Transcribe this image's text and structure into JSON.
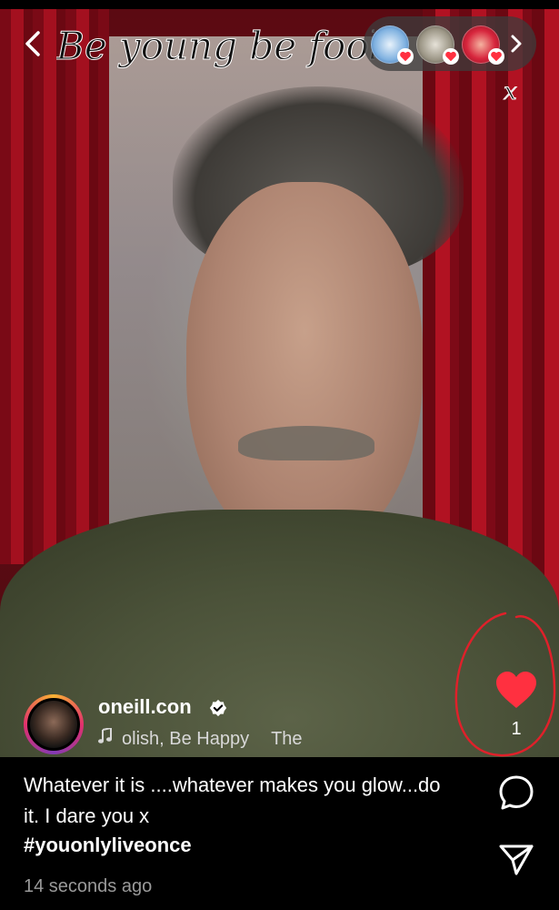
{
  "story": {
    "title": "Be young be foolish",
    "title_tail": "x",
    "back_icon": "chevron-left-icon"
  },
  "likers": {
    "count_shown": 3,
    "chevron_icon": "chevron-right-icon",
    "avatar_colors": [
      "#cfe3f5",
      "#bdb7a8",
      "#d7263d"
    ],
    "badge_icon": "heart-badge-icon"
  },
  "account": {
    "username": "oneill.con",
    "verified_icon": "verified-badge-icon",
    "music_track": "olish, Be Happy",
    "music_extra": "The",
    "music_icon": "music-note-icon"
  },
  "actions": {
    "like_icon": "heart-filled-icon",
    "like_color": "#ff3040",
    "like_count": "1",
    "comment_icon": "comment-icon",
    "share_icon": "send-icon"
  },
  "caption": {
    "text": "Whatever it is ....whatever makes you glow...do it. I dare you x",
    "hashtag": "#youonlyliveonce",
    "timestamp": "14 seconds ago"
  },
  "annotation": {
    "color": "#e0202a"
  }
}
